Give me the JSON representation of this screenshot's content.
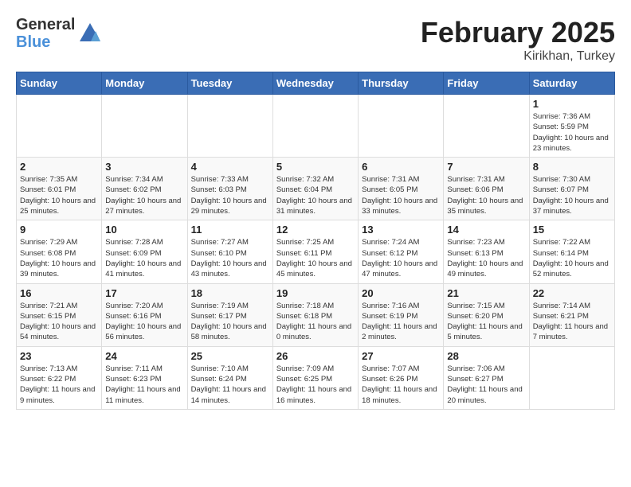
{
  "logo": {
    "general": "General",
    "blue": "Blue"
  },
  "title": "February 2025",
  "location": "Kirikhan, Turkey",
  "days_of_week": [
    "Sunday",
    "Monday",
    "Tuesday",
    "Wednesday",
    "Thursday",
    "Friday",
    "Saturday"
  ],
  "weeks": [
    [
      {
        "day": "",
        "info": ""
      },
      {
        "day": "",
        "info": ""
      },
      {
        "day": "",
        "info": ""
      },
      {
        "day": "",
        "info": ""
      },
      {
        "day": "",
        "info": ""
      },
      {
        "day": "",
        "info": ""
      },
      {
        "day": "1",
        "info": "Sunrise: 7:36 AM\nSunset: 5:59 PM\nDaylight: 10 hours and 23 minutes."
      }
    ],
    [
      {
        "day": "2",
        "info": "Sunrise: 7:35 AM\nSunset: 6:01 PM\nDaylight: 10 hours and 25 minutes."
      },
      {
        "day": "3",
        "info": "Sunrise: 7:34 AM\nSunset: 6:02 PM\nDaylight: 10 hours and 27 minutes."
      },
      {
        "day": "4",
        "info": "Sunrise: 7:33 AM\nSunset: 6:03 PM\nDaylight: 10 hours and 29 minutes."
      },
      {
        "day": "5",
        "info": "Sunrise: 7:32 AM\nSunset: 6:04 PM\nDaylight: 10 hours and 31 minutes."
      },
      {
        "day": "6",
        "info": "Sunrise: 7:31 AM\nSunset: 6:05 PM\nDaylight: 10 hours and 33 minutes."
      },
      {
        "day": "7",
        "info": "Sunrise: 7:31 AM\nSunset: 6:06 PM\nDaylight: 10 hours and 35 minutes."
      },
      {
        "day": "8",
        "info": "Sunrise: 7:30 AM\nSunset: 6:07 PM\nDaylight: 10 hours and 37 minutes."
      }
    ],
    [
      {
        "day": "9",
        "info": "Sunrise: 7:29 AM\nSunset: 6:08 PM\nDaylight: 10 hours and 39 minutes."
      },
      {
        "day": "10",
        "info": "Sunrise: 7:28 AM\nSunset: 6:09 PM\nDaylight: 10 hours and 41 minutes."
      },
      {
        "day": "11",
        "info": "Sunrise: 7:27 AM\nSunset: 6:10 PM\nDaylight: 10 hours and 43 minutes."
      },
      {
        "day": "12",
        "info": "Sunrise: 7:25 AM\nSunset: 6:11 PM\nDaylight: 10 hours and 45 minutes."
      },
      {
        "day": "13",
        "info": "Sunrise: 7:24 AM\nSunset: 6:12 PM\nDaylight: 10 hours and 47 minutes."
      },
      {
        "day": "14",
        "info": "Sunrise: 7:23 AM\nSunset: 6:13 PM\nDaylight: 10 hours and 49 minutes."
      },
      {
        "day": "15",
        "info": "Sunrise: 7:22 AM\nSunset: 6:14 PM\nDaylight: 10 hours and 52 minutes."
      }
    ],
    [
      {
        "day": "16",
        "info": "Sunrise: 7:21 AM\nSunset: 6:15 PM\nDaylight: 10 hours and 54 minutes."
      },
      {
        "day": "17",
        "info": "Sunrise: 7:20 AM\nSunset: 6:16 PM\nDaylight: 10 hours and 56 minutes."
      },
      {
        "day": "18",
        "info": "Sunrise: 7:19 AM\nSunset: 6:17 PM\nDaylight: 10 hours and 58 minutes."
      },
      {
        "day": "19",
        "info": "Sunrise: 7:18 AM\nSunset: 6:18 PM\nDaylight: 11 hours and 0 minutes."
      },
      {
        "day": "20",
        "info": "Sunrise: 7:16 AM\nSunset: 6:19 PM\nDaylight: 11 hours and 2 minutes."
      },
      {
        "day": "21",
        "info": "Sunrise: 7:15 AM\nSunset: 6:20 PM\nDaylight: 11 hours and 5 minutes."
      },
      {
        "day": "22",
        "info": "Sunrise: 7:14 AM\nSunset: 6:21 PM\nDaylight: 11 hours and 7 minutes."
      }
    ],
    [
      {
        "day": "23",
        "info": "Sunrise: 7:13 AM\nSunset: 6:22 PM\nDaylight: 11 hours and 9 minutes."
      },
      {
        "day": "24",
        "info": "Sunrise: 7:11 AM\nSunset: 6:23 PM\nDaylight: 11 hours and 11 minutes."
      },
      {
        "day": "25",
        "info": "Sunrise: 7:10 AM\nSunset: 6:24 PM\nDaylight: 11 hours and 14 minutes."
      },
      {
        "day": "26",
        "info": "Sunrise: 7:09 AM\nSunset: 6:25 PM\nDaylight: 11 hours and 16 minutes."
      },
      {
        "day": "27",
        "info": "Sunrise: 7:07 AM\nSunset: 6:26 PM\nDaylight: 11 hours and 18 minutes."
      },
      {
        "day": "28",
        "info": "Sunrise: 7:06 AM\nSunset: 6:27 PM\nDaylight: 11 hours and 20 minutes."
      },
      {
        "day": "",
        "info": ""
      }
    ]
  ]
}
